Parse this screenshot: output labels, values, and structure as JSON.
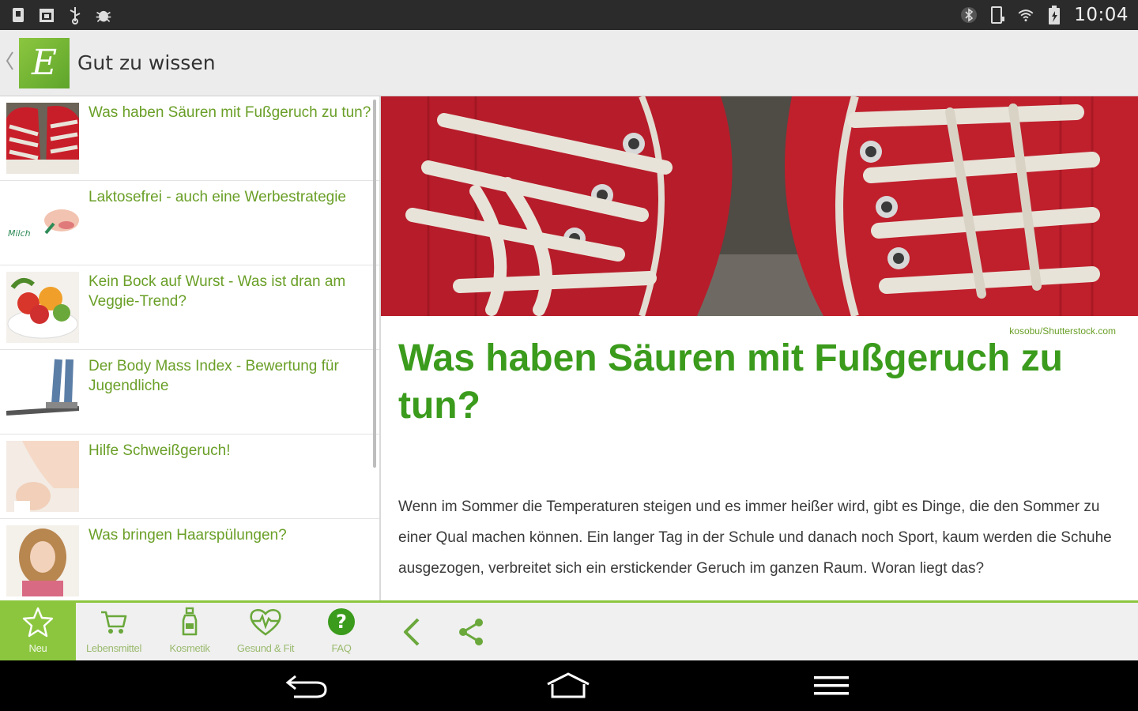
{
  "status_bar": {
    "time": "10:04"
  },
  "app": {
    "title": "Gut zu wissen",
    "logo_letter": "E"
  },
  "list": {
    "items": [
      {
        "title": "Was haben Säuren mit Fußgeruch zu tun?",
        "thumb": "sneakers-thumb"
      },
      {
        "title": "Laktosefrei - auch eine Werbestrategie",
        "thumb": "milk-thumb"
      },
      {
        "title": "Kein Bock auf Wurst - Was ist dran am Veggie-Trend?",
        "thumb": "salad-thumb"
      },
      {
        "title": "Der Body Mass Index - Bewertung für Jugendliche",
        "thumb": "scale-thumb"
      },
      {
        "title": "Hilfe Schweißgeruch!",
        "thumb": "armpit-thumb"
      },
      {
        "title": "Was bringen Haarspülungen?",
        "thumb": "hair-thumb"
      }
    ]
  },
  "article": {
    "image_credit": "kosobu/Shutterstock.com",
    "headline": "Was haben Säuren mit Fußgeruch zu tun?",
    "body": "Wenn im Sommer die Temperaturen steigen und es immer heißer wird, gibt es Dinge, die den Sommer zu einer Qual machen können. Ein langer Tag in der Schule und danach noch Sport, kaum werden die Schuhe ausgezogen, verbreitet sich ein erstickender Geruch im ganzen Raum. Woran liegt das?"
  },
  "tabs": [
    {
      "label": "Neu",
      "icon": "star-icon",
      "active": true
    },
    {
      "label": "Lebensmittel",
      "icon": "cart-icon",
      "active": false
    },
    {
      "label": "Kosmetik",
      "icon": "bottle-icon",
      "active": false
    },
    {
      "label": "Gesund & Fit",
      "icon": "heart-pulse-icon",
      "active": false
    },
    {
      "label": "FAQ",
      "icon": "question-icon",
      "active": false
    }
  ],
  "colors": {
    "accent": "#8cc63f",
    "headline": "#3b9b1c",
    "list_text": "#6a9f27"
  }
}
